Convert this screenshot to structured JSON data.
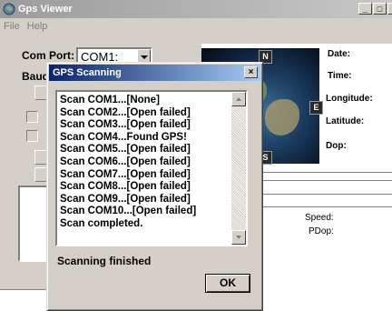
{
  "main_window": {
    "title": "Gps Viewer",
    "menu": [
      "File",
      "Help"
    ],
    "com_port_label": "Com Port:",
    "com_port_value": "COM1:",
    "baud_label": "Baud"
  },
  "data_panel": {
    "compass": {
      "north": "N",
      "east": "E",
      "south": "S"
    },
    "date_label": "Date:",
    "time_label": "Time:",
    "longitude_label": "Longitude:",
    "latitude_label": "Latitude:",
    "dop_label": "Dop:",
    "speed_label": "Speed:",
    "pdop_label": "PDop:"
  },
  "dialog": {
    "title": "GPS Scanning",
    "close_glyph": "×",
    "log": [
      "Scan COM1...[None]",
      "Scan COM2...[Open failed]",
      "Scan COM3...[Open failed]",
      "Scan COM4...Found GPS!",
      "Scan COM5...[Open failed]",
      "Scan COM6...[Open failed]",
      "Scan COM7...[Open failed]",
      "Scan COM8...[Open failed]",
      "Scan COM9...[Open failed]",
      "Scan COM10...[Open failed]",
      "Scan completed."
    ],
    "status": "Scanning finished",
    "ok_label": "OK"
  },
  "colors": {
    "active_title": "#0a246a",
    "inactive_title": "#9c9c9c",
    "face": "#d4d0c8"
  },
  "icons": [
    "gps-app-icon",
    "minimize-icon",
    "maximize-icon",
    "close-icon",
    "scroll-up-arrow-icon",
    "scroll-down-arrow-icon"
  ]
}
